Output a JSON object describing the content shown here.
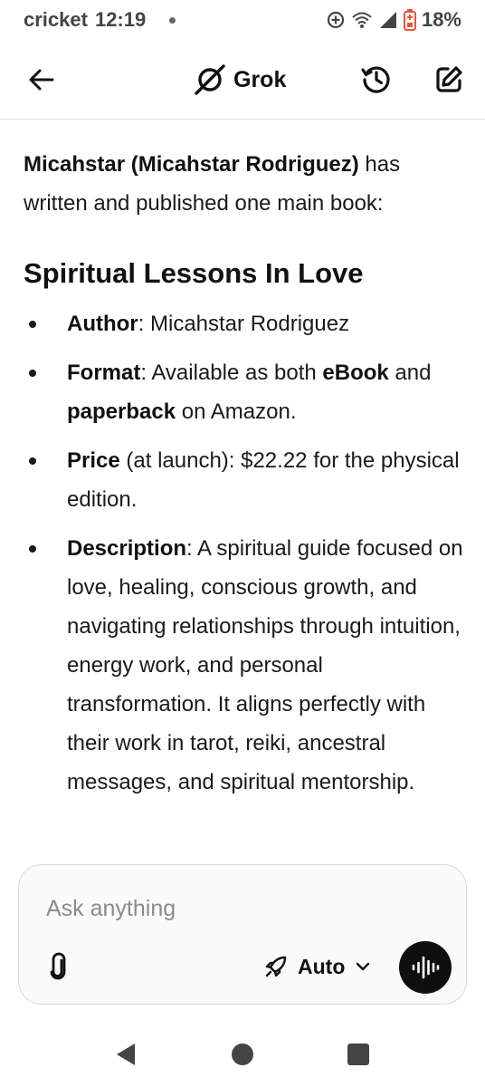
{
  "status_bar": {
    "carrier": "cricket",
    "time": "12:19",
    "battery": "18%",
    "icons": [
      "data-saver-icon",
      "wifi-icon",
      "signal-icon",
      "battery-low-icon"
    ]
  },
  "header": {
    "title": "Grok",
    "icons": [
      "back-arrow-icon",
      "grok-logo-icon",
      "history-icon",
      "new-chat-icon"
    ]
  },
  "message": {
    "intro_bold": "Micahstar (Micahstar Rodriguez)",
    "intro_rest": " has written and published one main book:",
    "book_title": "Spiritual Lessons In Love",
    "bullets": [
      {
        "label": "Author",
        "parts": [
          ": Micahstar Rodriguez"
        ]
      },
      {
        "label": "Format",
        "p1": ": Available as both ",
        "b1": "eBook",
        "p2": " and ",
        "b2": "paperback",
        "p3": " on Amazon."
      },
      {
        "label": "Price",
        "text": " (at launch): $22.22 for the physical edition."
      },
      {
        "label": "Description",
        "text": ": A spiritual guide focused on love, healing, conscious growth, and navigating relationships through intuition, energy work, and personal transformation. It aligns perfectly with their work in tarot, reiki, ancestral messages, and spiritual mentorship."
      }
    ]
  },
  "composer": {
    "placeholder": "Ask anything",
    "value": "",
    "mode": "Auto",
    "icons": [
      "paperclip-icon",
      "rocket-icon",
      "chevron-down-icon",
      "voice-waveform-icon"
    ]
  },
  "nav_bar": {
    "icons": [
      "nav-back-icon",
      "nav-home-icon",
      "nav-recents-icon"
    ]
  },
  "colors": {
    "text": "#111111",
    "border": "#d9d9d9",
    "voice_button": "#0f0f0f",
    "battery_warning": "#e8563a"
  }
}
